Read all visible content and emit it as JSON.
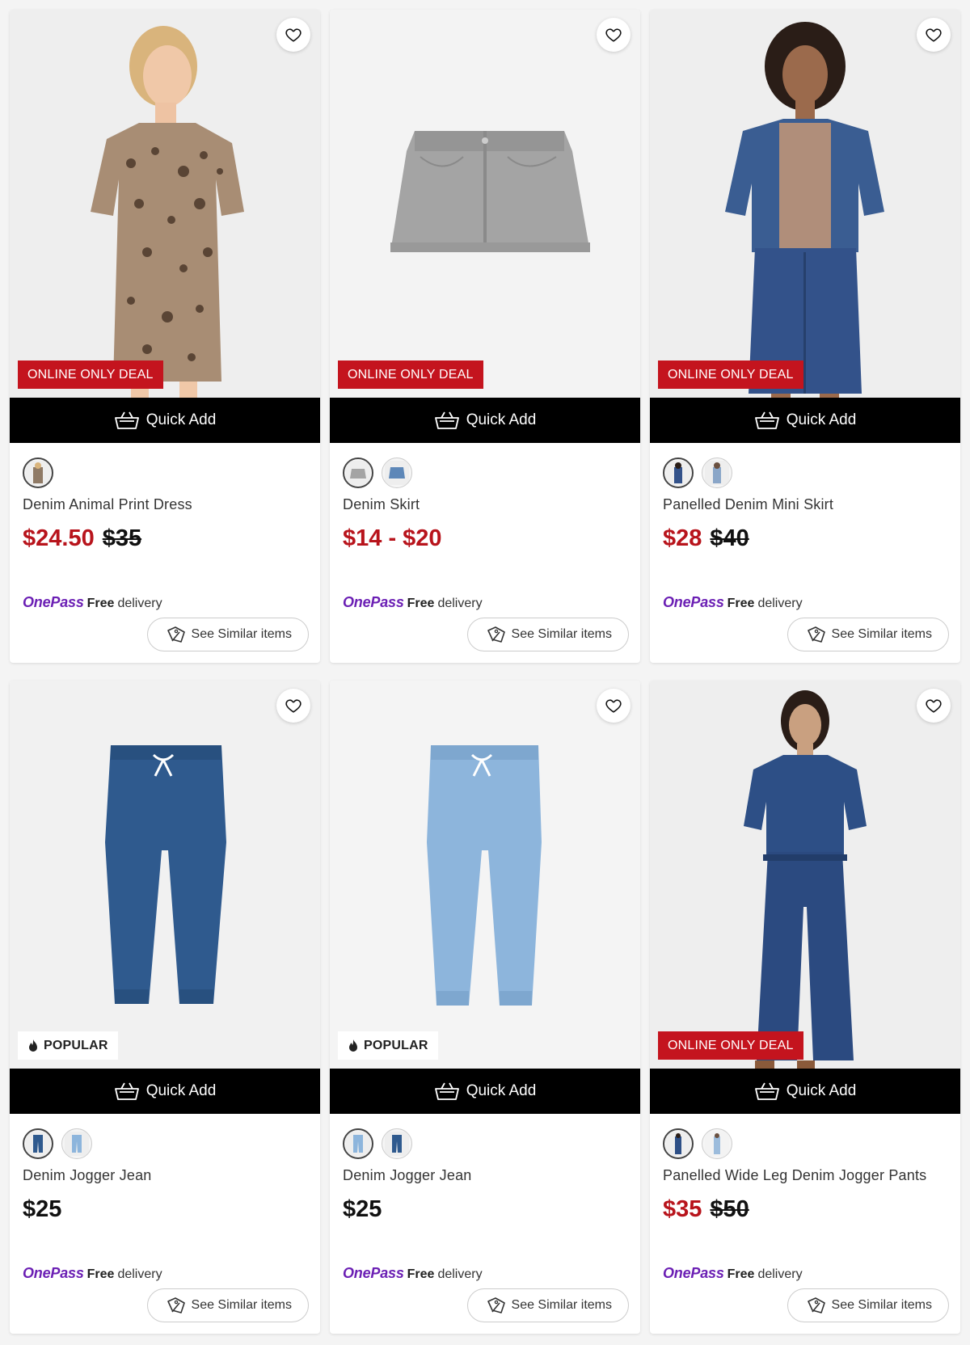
{
  "colors": {
    "deal_red": "#c4141e",
    "price_red": "#b8141c",
    "onepass_purple": "#6b1fb4",
    "quick_add_bg": "#000000"
  },
  "common": {
    "quick_add": "Quick Add",
    "onepass": "OnePass",
    "free": "Free",
    "delivery": "delivery",
    "see_similar": "See Similar items",
    "icons": {
      "favourite": "heart-icon",
      "quick_add": "basket-icon",
      "similar": "tag-icon",
      "popular": "flame-icon"
    }
  },
  "products": [
    {
      "name": "Denim Animal Print Dress",
      "price": "$24.50",
      "was_price": "$35",
      "price_style": "red",
      "badge": "ONLINE ONLY DEAL",
      "badge_type": "deal",
      "swatch_count": 1,
      "image": "girl-leopard-dress"
    },
    {
      "name": "Denim Skirt",
      "price": "$14 - $20",
      "was_price": "",
      "price_style": "red",
      "badge": "ONLINE ONLY DEAL",
      "badge_type": "deal",
      "swatch_count": 2,
      "image": "grey-denim-skirt"
    },
    {
      "name": "Panelled Denim Mini Skirt",
      "price": "$28",
      "was_price": "$40",
      "price_style": "red",
      "badge": "ONLINE ONLY DEAL",
      "badge_type": "deal",
      "swatch_count": 2,
      "image": "woman-denim-mini-skirt"
    },
    {
      "name": "Denim Jogger Jean",
      "price": "$25",
      "was_price": "",
      "price_style": "black",
      "badge": "POPULAR",
      "badge_type": "popular",
      "swatch_count": 2,
      "image": "dark-denim-jogger"
    },
    {
      "name": "Denim Jogger Jean",
      "price": "$25",
      "was_price": "",
      "price_style": "black",
      "badge": "POPULAR",
      "badge_type": "popular",
      "swatch_count": 2,
      "image": "light-denim-jogger"
    },
    {
      "name": "Panelled Wide Leg Denim Jogger Pants",
      "price": "$35",
      "was_price": "$50",
      "price_style": "red",
      "badge": "ONLINE ONLY DEAL",
      "badge_type": "deal",
      "swatch_count": 2,
      "image": "woman-wide-leg-denim"
    }
  ]
}
